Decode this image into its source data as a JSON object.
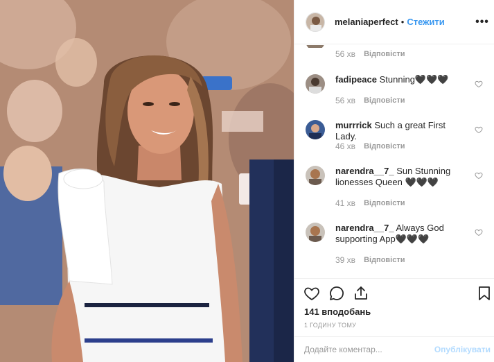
{
  "post": {
    "username": "melaniaperfect",
    "separator": "•",
    "follow_label": "Стежити",
    "more_icon": "more-horizontal-icon"
  },
  "top_comment_meta": {
    "time": "56 хв",
    "reply_label": "Відповісти"
  },
  "comments": [
    {
      "username": "fadipeace",
      "text": "Stunning🖤🖤🖤",
      "time": "56 хв",
      "reply_label": "Відповісти"
    },
    {
      "username": "murrrick",
      "text": "Such a great First Lady.",
      "time": "46 хв",
      "reply_label": "Відповісти"
    },
    {
      "username": "narendra__7_",
      "text": "Sun Stunning lionesses Queen 🖤🖤🖤",
      "time": "41 хв",
      "reply_label": "Відповісти"
    },
    {
      "username": "narendra__7_",
      "text": "Always God supporting App🖤🖤🖤",
      "time": "39 хв",
      "reply_label": "Відповісти"
    }
  ],
  "actions": {
    "like_icon": "heart-icon",
    "comment_icon": "comment-icon",
    "share_icon": "share-icon",
    "save_icon": "bookmark-icon",
    "likes_text": "141 вподобань",
    "posted_ago": "1 ГОДИНУ ТОМУ"
  },
  "composer": {
    "placeholder": "Додайте коментар...",
    "publish_label": "Опублікувати"
  },
  "colors": {
    "link": "#3897f0",
    "muted": "#999999",
    "border": "#efefef",
    "publish_disabled": "#b3dbff"
  }
}
